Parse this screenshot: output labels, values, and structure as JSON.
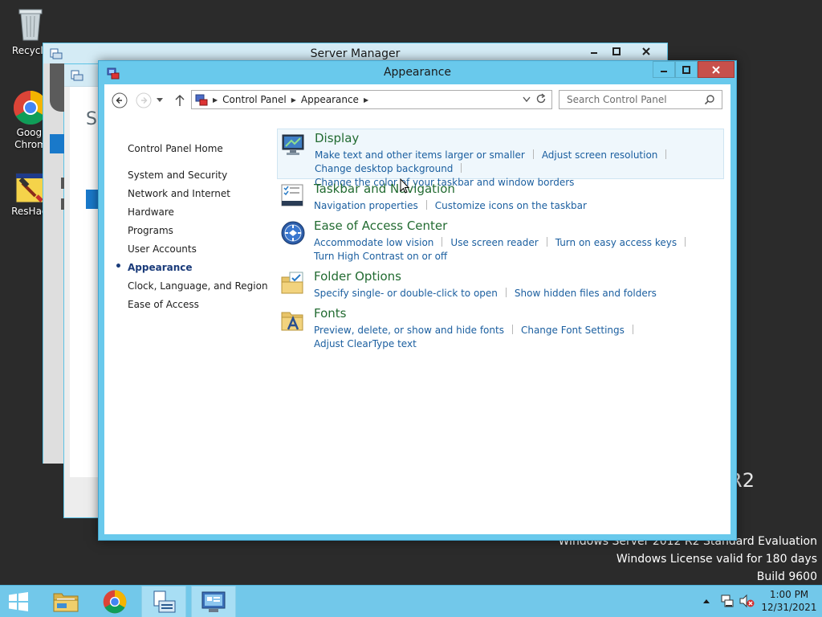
{
  "desktop": {
    "icons": [
      {
        "label": "Recycle"
      },
      {
        "label": "Googl Chrom"
      },
      {
        "label": "ResHacl"
      }
    ],
    "watermark": {
      "r2": "R2",
      "edition": "Windows Server 2012 R2 Standard Evaluation",
      "license": "Windows License valid for 180 days",
      "build": "Build 9600"
    }
  },
  "server_manager": {
    "title": "Server Manager",
    "fragment": "Se"
  },
  "window": {
    "title": "Appearance",
    "caption": {
      "minimize": "—",
      "maximize": "☐",
      "close": "✕"
    }
  },
  "address_bar": {
    "crumbs": [
      "Control Panel",
      "Appearance"
    ],
    "search_placeholder": "Search Control Panel"
  },
  "left_nav": {
    "home": "Control Panel Home",
    "items": [
      {
        "label": "System and Security",
        "selected": false
      },
      {
        "label": "Network and Internet",
        "selected": false
      },
      {
        "label": "Hardware",
        "selected": false
      },
      {
        "label": "Programs",
        "selected": false
      },
      {
        "label": "User Accounts",
        "selected": false
      },
      {
        "label": "Appearance",
        "selected": true
      },
      {
        "label": "Clock, Language, and Region",
        "selected": false
      },
      {
        "label": "Ease of Access",
        "selected": false
      }
    ]
  },
  "categories": [
    {
      "heading": "Display",
      "icon": "display-icon",
      "links": [
        "Make text and other items larger or smaller",
        "Adjust screen resolution",
        "Change desktop background",
        "Change the color of your taskbar and window borders"
      ]
    },
    {
      "heading": "Taskbar and Navigation",
      "icon": "taskbar-icon",
      "links": [
        "Navigation properties",
        "Customize icons on the taskbar"
      ]
    },
    {
      "heading": "Ease of Access Center",
      "icon": "ease-of-access-icon",
      "links": [
        "Accommodate low vision",
        "Use screen reader",
        "Turn on easy access keys",
        "Turn High Contrast on or off"
      ]
    },
    {
      "heading": "Folder Options",
      "icon": "folder-options-icon",
      "links": [
        "Specify single- or double-click to open",
        "Show hidden files and folders"
      ]
    },
    {
      "heading": "Fonts",
      "icon": "fonts-icon",
      "links": [
        "Preview, delete, or show and hide fonts",
        "Change Font Settings",
        "Adjust ClearType text"
      ]
    }
  ],
  "taskbar": {
    "time": "1:00 PM",
    "date": "12/31/2021"
  },
  "colors": {
    "accent": "#69c9ec",
    "heading_green": "#226b31",
    "link_blue": "#1a5e9f",
    "taskbar": "#72c8ea"
  }
}
